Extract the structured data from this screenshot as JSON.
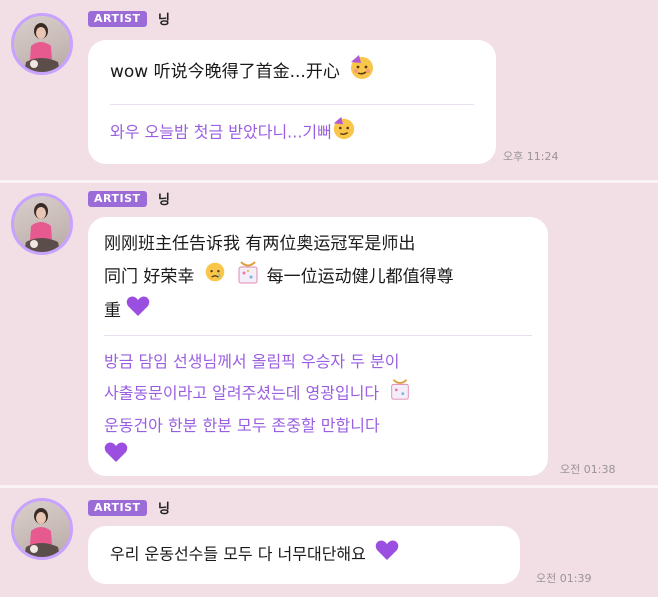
{
  "messages": [
    {
      "badge": "ARTIST",
      "name": "닝",
      "original": "wow 听说今晚得了首金...开心",
      "translation": "와우 오늘밤 첫금 받았다니...기뻐",
      "time": "오후 11:24"
    },
    {
      "badge": "ARTIST",
      "name": "닝",
      "original_lines": [
        "刚刚班主任告诉我 有两位奥运冠军是师出",
        "同门 好荣幸",
        "每一位运动健儿都值得尊",
        "重"
      ],
      "translation_lines": [
        "방금 담임 선생님께서 올림픽 우승자 두 분이",
        "사출동문이라고 알려주셨는데 영광입니다",
        "운동건아 한분 한분 모두 존중할 만합니다"
      ],
      "time": "오전 01:38"
    },
    {
      "badge": "ARTIST",
      "name": "닝",
      "translation": "우리 운동선수들 모두 다 너무대단해요",
      "time": "오전 01:39"
    }
  ],
  "icons": [
    "partying-face-icon",
    "crying-face-icon",
    "sparkle-ribbon-icon",
    "purple-heart-icon"
  ],
  "colors": {
    "background": "#f2dfe5",
    "badge": "#9b6bd8",
    "translation_text": "#9a5fe0",
    "bubble": "#ffffff",
    "heart": "#9b4fe0"
  }
}
